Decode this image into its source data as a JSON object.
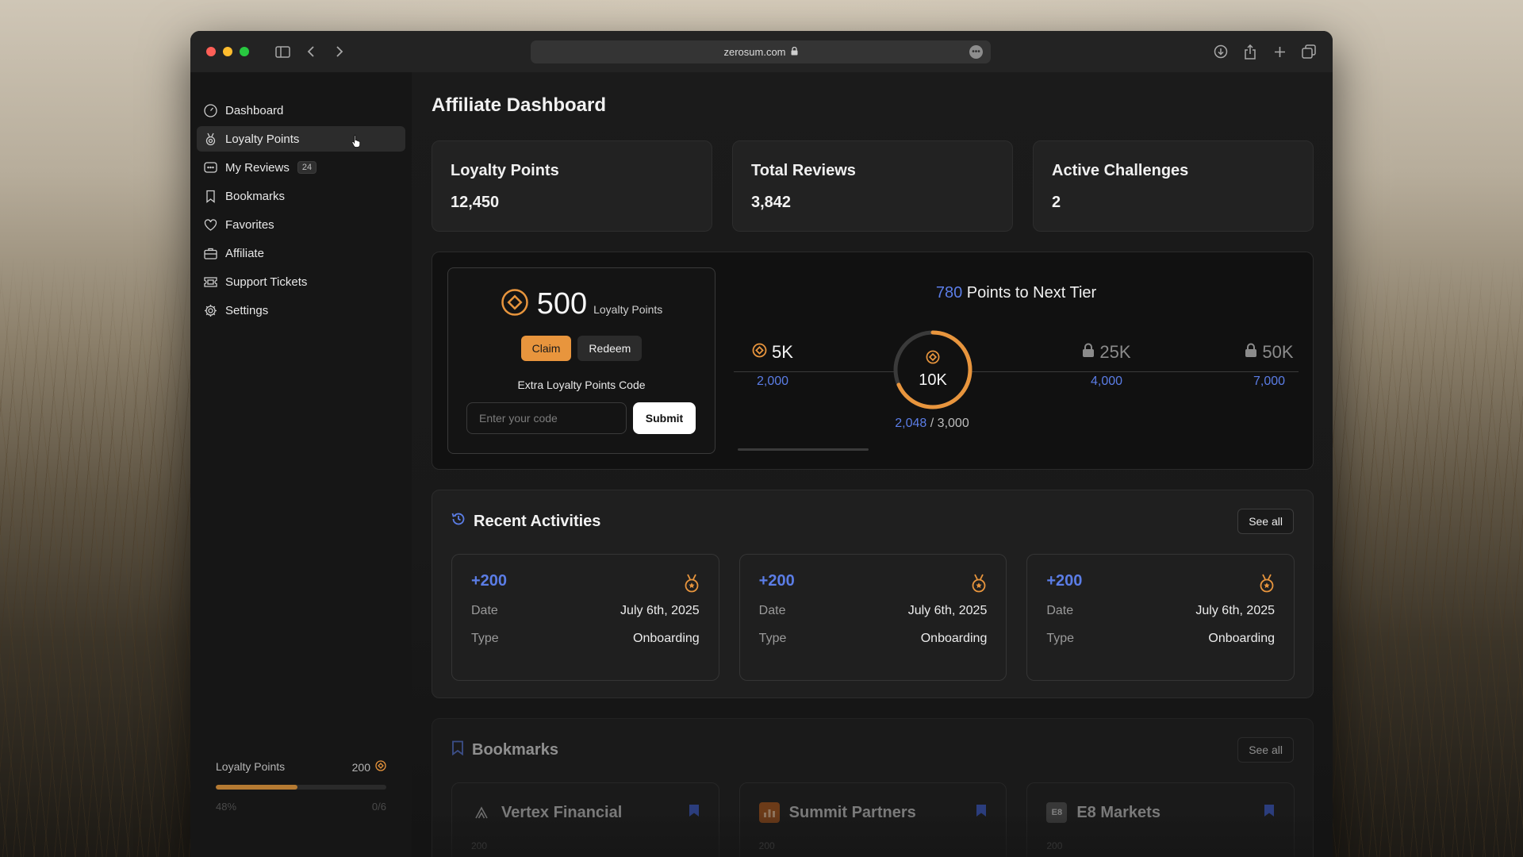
{
  "browser": {
    "url": "zerosum.com"
  },
  "sidebar": {
    "items": [
      {
        "label": "Dashboard",
        "icon": "dashboard-gauge-icon"
      },
      {
        "label": "Loyalty Points",
        "icon": "medal-icon",
        "active": true
      },
      {
        "label": "My Reviews",
        "icon": "message-icon",
        "badge": "24"
      },
      {
        "label": "Bookmarks",
        "icon": "bookmark-icon"
      },
      {
        "label": "Favorites",
        "icon": "heart-icon"
      },
      {
        "label": "Affiliate",
        "icon": "briefcase-icon"
      },
      {
        "label": "Support Tickets",
        "icon": "ticket-icon"
      },
      {
        "label": "Settings",
        "icon": "gear-icon"
      }
    ],
    "footer": {
      "label": "Loyalty Points",
      "value": "200",
      "progress": 0.48,
      "percent_label": "48%",
      "count_label": "0/6"
    }
  },
  "main": {
    "title": "Affiliate Dashboard",
    "stats": [
      {
        "label": "Loyalty Points",
        "value": "12,450"
      },
      {
        "label": "Total Reviews",
        "value": "3,842"
      },
      {
        "label": "Active Challenges",
        "value": "2"
      }
    ],
    "claim": {
      "amount": "500",
      "unit": "Loyalty Points",
      "claim_label": "Claim",
      "redeem_label": "Redeem",
      "code_label": "Extra Loyalty Points Code",
      "code_placeholder": "Enter your code",
      "submit_label": "Submit"
    },
    "tiers": {
      "points_needed": "780",
      "points_needed_suffix": "Points to Next Tier",
      "levels": [
        {
          "label": "5K",
          "sub": "2,000",
          "state": "completed"
        },
        {
          "label": "10K",
          "state": "current"
        },
        {
          "label": "25K",
          "sub": "4,000",
          "state": "locked"
        },
        {
          "label": "50K",
          "sub": "7,000",
          "state": "locked"
        }
      ],
      "current_progress": "2,048",
      "current_target": "/ 3,000",
      "ring_fraction": 0.683
    },
    "activities": {
      "title": "Recent Activities",
      "see_all": "See all",
      "items": [
        {
          "points": "+200",
          "date_label": "Date",
          "date": "July 6th, 2025",
          "type_label": "Type",
          "type": "Onboarding"
        },
        {
          "points": "+200",
          "date_label": "Date",
          "date": "July 6th, 2025",
          "type_label": "Type",
          "type": "Onboarding"
        },
        {
          "points": "+200",
          "date_label": "Date",
          "date": "July 6th, 2025",
          "type_label": "Type",
          "type": "Onboarding"
        }
      ]
    },
    "bookmarks": {
      "title": "Bookmarks",
      "see_all": "See all",
      "items": [
        {
          "name": "Vertex Financial",
          "sub": "200"
        },
        {
          "name": "Summit Partners",
          "sub": "200"
        },
        {
          "name": "E8 Markets",
          "logo_text": "E8",
          "sub": "200"
        }
      ]
    }
  },
  "colors": {
    "accent_orange": "#e8953d",
    "accent_blue": "#5b7de6",
    "background": "#121212"
  }
}
